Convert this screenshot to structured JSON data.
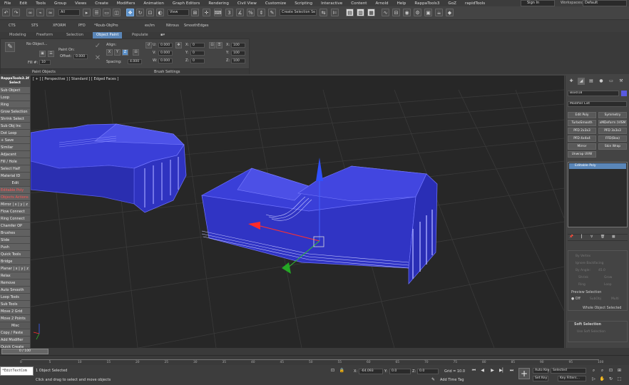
{
  "menu": [
    "File",
    "Edit",
    "Tools",
    "Group",
    "Views",
    "Create",
    "Modifiers",
    "Animation",
    "Graph Editors",
    "Rendering",
    "Civil View",
    "Customize",
    "Scripting",
    "Interactive",
    "Content",
    "Arnold",
    "Help",
    "RappaTools3",
    "GoZ",
    "rapidTools"
  ],
  "signin": "Sign In",
  "workspace": {
    "label": "Workspaces:",
    "value": "Default"
  },
  "toolbar": {
    "filter": "All",
    "refcoord": "View",
    "selset": "Create Selection Se"
  },
  "shelf": [
    "CTS",
    "STS",
    "XFORM",
    "PFD",
    "*Roub-ObjPro",
    "ex/im",
    "Nitrous",
    "SmoothEdges"
  ],
  "ribbon_tabs": [
    "Modeling",
    "Freeform",
    "Selection",
    "Object Paint",
    "Populate"
  ],
  "ribbon": {
    "no_object": "No Object...",
    "paint_on": "Paint On:",
    "offset": "Offset:",
    "offset_val": "0.000",
    "fill": "Fill #:",
    "fill_val": "10",
    "align": "Align:",
    "spacing": "Spacing:",
    "spacing_val": "4.000",
    "axes": [
      "X",
      "Y",
      "Z"
    ],
    "u": "U:",
    "v": "V:",
    "w": "W:",
    "uval": "0.000",
    "vval": "0.000",
    "wval": "0.000",
    "x": "X:",
    "y": "Y:",
    "z": "Z:",
    "xval": "0",
    "yval": "0",
    "zval": "0",
    "sx": "X:",
    "sy": "Y:",
    "sz": "Z:",
    "sxval": "100",
    "syval": "100",
    "szval": "100",
    "group1": "Paint Objects",
    "group2": "Brush Settings"
  },
  "left_panel": {
    "title": "RappaTools3.3f",
    "select": "Select",
    "buttons": [
      "Sub Object",
      "Loop",
      "Ring",
      "Grow Selection",
      "Shrink Select",
      "Sub Obj Inc",
      "Dot Loop",
      "+ Save",
      "Similar",
      "Adjacent",
      "Fill / Hole",
      "Select Half",
      "Material ID",
      "Edit",
      "Editable Poly",
      "Objects Actions",
      "Mirror | x | y | z",
      "Flow Connect",
      "Ring Connect",
      "Chamfer OP",
      "Brushes",
      "Slide",
      "Push",
      "Quick Tools",
      "Bridge",
      "Planar | x | y | z",
      "Relax",
      "Remove",
      "Auto Smooth",
      "Loop Tools",
      "Sub Tools",
      "Move 2 Grid",
      "Move 2 Points",
      "Misc",
      "Copy / Paste",
      "Add Modifier",
      "Quick Create"
    ]
  },
  "viewport": {
    "label": "[ + ] [ Perspective ] [ Standard ] [ Edged Faces ]"
  },
  "command_panel": {
    "object_name": "Box018",
    "modifier_list": "Modifier List",
    "mod_buttons": [
      "Edit Poly",
      "Symmetry",
      "TurboSmooth",
      "xMDeform (VISM",
      "PFD 2x3x3",
      "PFD 3x3x3",
      "PFD 4x4x4",
      "FFD(Box)",
      "Mirror",
      "Skin Wrap",
      "Unwrap UVW"
    ],
    "stack_item": "Editable Poly",
    "dim_rows": [
      "By Vertex",
      "Ignore Backfacing",
      "By Angle:",
      "Shrink",
      "Grow",
      "Ring",
      "Loop"
    ],
    "angle_val": "45.0",
    "preview_label": "Preview Selection",
    "preview_opts": [
      "Off",
      "SubObj",
      "Multi"
    ],
    "whole_object": "Whole Object Selected",
    "soft_sel": "Soft Selection",
    "soft_sub": "Use Soft Selection"
  },
  "time": {
    "slider": "0 / 100",
    "ticks": [
      "0",
      "5",
      "10",
      "15",
      "20",
      "25",
      "30",
      "35",
      "40",
      "45",
      "50",
      "55",
      "60",
      "65",
      "70",
      "75",
      "80",
      "85",
      "90",
      "95",
      "100"
    ]
  },
  "status": {
    "maxscript": "*EditTextCom",
    "selected": "1 Object Selected",
    "prompt": "Click and drag to select and move objects",
    "x_label": "X:",
    "x_val": "-64.093",
    "y_label": "Y:",
    "y_val": "0.0",
    "z_label": "Z:",
    "z_val": "0.0",
    "grid": "Grid = 10.0",
    "add_tag": "Add Time Tag",
    "autokey": "Auto Key",
    "setkey": "Set Key",
    "sel_dd": "Selected",
    "keyfilters": "Key Filters..."
  }
}
